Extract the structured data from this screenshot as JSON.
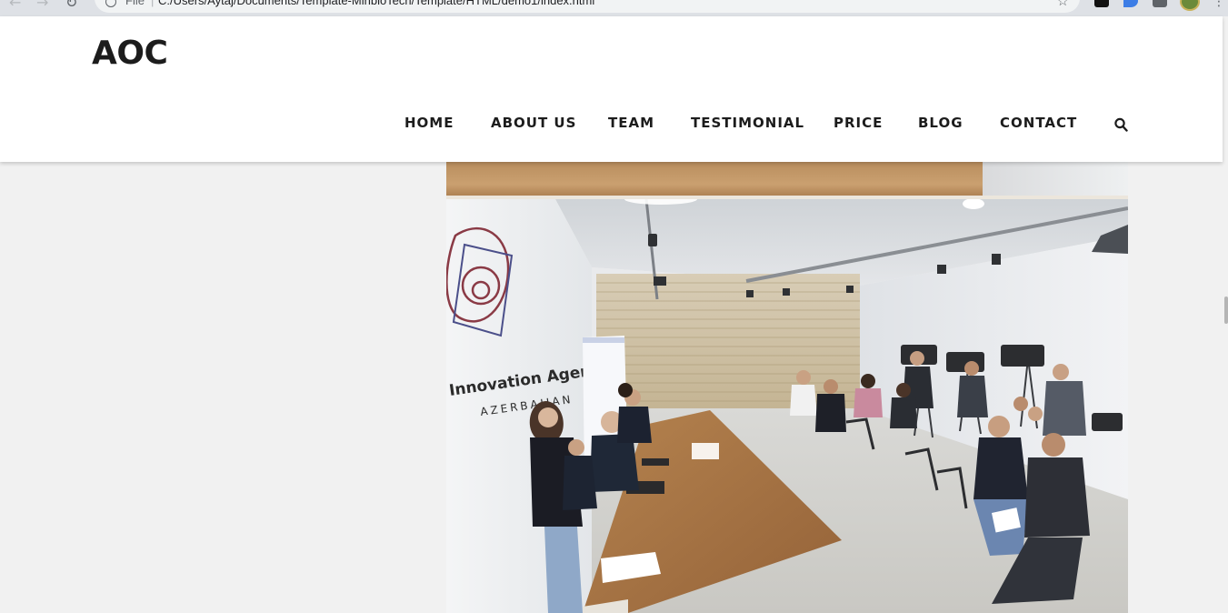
{
  "browser": {
    "scheme_label": "File",
    "separator": "|",
    "url": "C:/Users/Aytaj/Documents/Template-MinbioTech/Template/HTML/demo1/index.html",
    "icons": [
      "back-arrow-icon",
      "forward-arrow-icon",
      "reload-icon",
      "info-icon",
      "star-icon",
      "extension-icon",
      "puzzle-icon",
      "profile-avatar",
      "menu-dots-icon"
    ]
  },
  "header": {
    "logo": "AOC",
    "nav": [
      {
        "label": "HOME"
      },
      {
        "label": "ABOUT US"
      },
      {
        "label": "TEAM"
      },
      {
        "label": "TESTIMONIAL"
      },
      {
        "label": "PRICE"
      },
      {
        "label": "BLOG"
      },
      {
        "label": "CONTACT"
      }
    ],
    "search_icon": "search-icon"
  },
  "photo": {
    "sign_line1": "Innovation Agency",
    "sign_line2": "AZERBAIJAN",
    "colors": {
      "wall": "#e8ebee",
      "table": "#a8764a",
      "floor": "#d8d8d6"
    }
  },
  "colors": {
    "page_background": "#f1f1f1",
    "header_background": "#ffffff",
    "text_dark": "#1c1c1c"
  }
}
